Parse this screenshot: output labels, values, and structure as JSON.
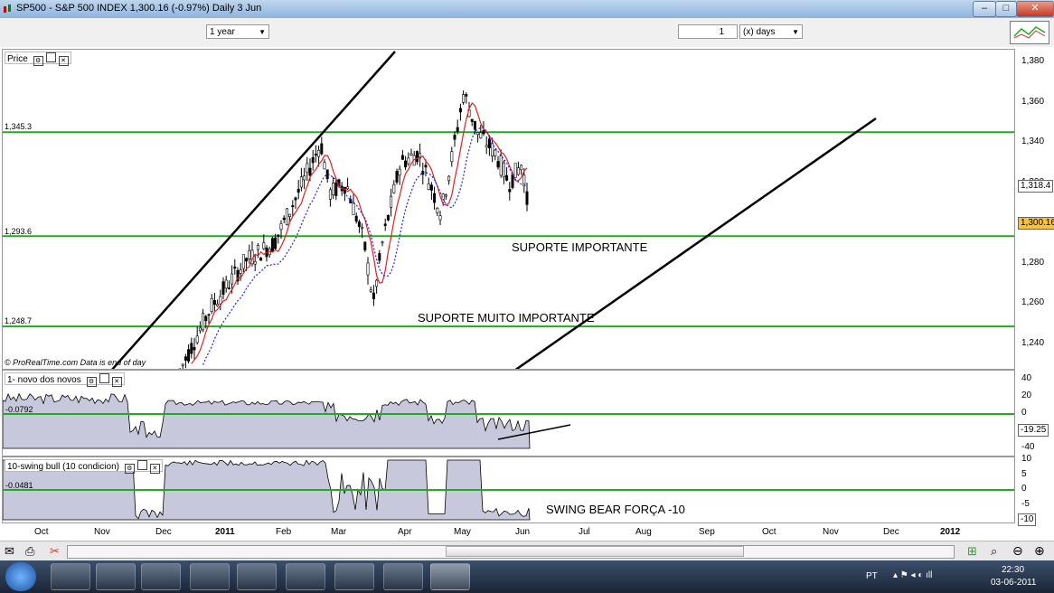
{
  "window": {
    "title": "SP500 - S&P 500 INDEX   1,300.16 (-0.97%)   Daily  3 Jun",
    "min_label": "–",
    "max_label": "□",
    "close_label": "✕"
  },
  "toolbar": {
    "period_value": "1 year",
    "units_value": "1",
    "units_type": "(x) days"
  },
  "price_panel": {
    "label": "Price",
    "watermark": "© ProRealTime.com  Data is end of day",
    "levels": [
      {
        "value": 1345.3,
        "label": "1,345.3"
      },
      {
        "value": 1293.6,
        "label": "1,293.6"
      },
      {
        "value": 1248.7,
        "label": "1,248.7"
      }
    ],
    "y_ticks": [
      "1,380",
      "1,360",
      "1,340",
      "1,320",
      "1,300",
      "1,280",
      "1,260",
      "1,240"
    ],
    "y_tick_values": [
      1380,
      1360,
      1340,
      1320,
      1300,
      1280,
      1260,
      1240
    ],
    "tag_ma": "1,318.4",
    "tag_ma_value": 1318.4,
    "tag_last": "1,300.16",
    "tag_last_value": 1300.16,
    "annotation_support": "SUPORTE IMPORTANTE",
    "annotation_strong_support": "SUPORTE MUITO IMPORTANTE"
  },
  "indicator1": {
    "label": "1- novo dos novos",
    "value_label": "-0.0792",
    "y_ticks": [
      "40",
      "20",
      "0",
      "-20",
      "-40"
    ],
    "y_tick_values": [
      40,
      20,
      0,
      -20,
      -40
    ],
    "tag": "-19.25",
    "tag_value": -19.25
  },
  "indicator2": {
    "label": "10-swing bull (10 condicion)",
    "value_label": "-0.0481",
    "y_ticks": [
      "10",
      "5",
      "0",
      "-5"
    ],
    "y_tick_values": [
      10,
      5,
      0,
      -5
    ],
    "tag": "-10",
    "tag_value": -10,
    "annotation": "SWING BEAR FORÇA -10"
  },
  "x_axis": {
    "labels": [
      "Oct",
      "Nov",
      "Dec",
      "2011",
      "Feb",
      "Mar",
      "Apr",
      "May",
      "Jun",
      "Jul",
      "Aug",
      "Sep",
      "Oct",
      "Nov",
      "Dec",
      "2012"
    ]
  },
  "taskbar": {
    "lang": "PT",
    "time": "22:30",
    "date": "03-06-2011"
  },
  "colors": {
    "level_line": "#22aa22",
    "ma_fast": "#dd2222",
    "ma_slow": "#2222dd",
    "indicator_fill": "#c8c8dc"
  }
}
